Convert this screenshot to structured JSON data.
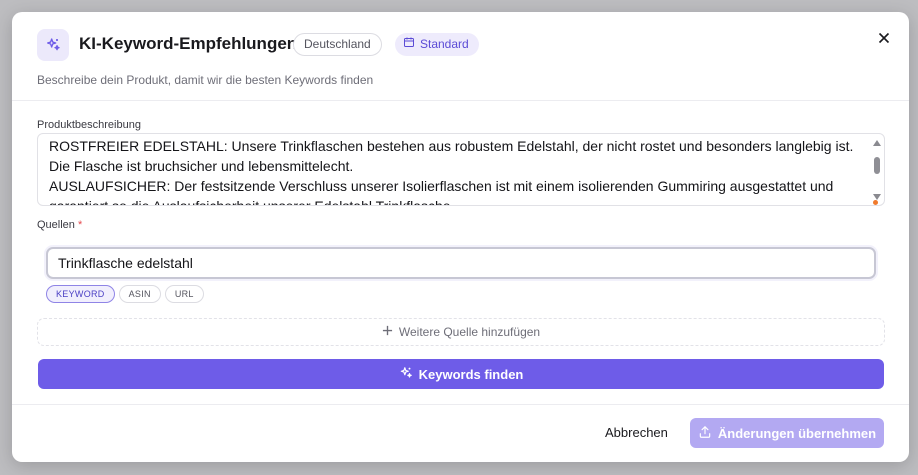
{
  "dialog": {
    "title": "KI-Keyword-Empfehlungen",
    "country_badge": "Deutschland",
    "mode_badge": "Standard",
    "subtitle": "Beschreibe dein Produkt, damit wir die besten Keywords finden"
  },
  "description": {
    "label": "Produktbeschreibung",
    "value": "ROSTFREIER EDELSTAHL: Unsere Trinkflaschen bestehen aus robustem Edelstahl, der nicht rostet und besonders langlebig ist. Die Flasche ist bruchsicher und lebensmittelecht.\nAUSLAUFSICHER: Der festsitzende Verschluss unserer Isolierflaschen ist mit einem isolierenden Gummiring ausgestattet und garantiert so die Auslaufsicherheit unserer Edelstahl Trinkflasche."
  },
  "sources": {
    "label": "Quellen",
    "required_mark": "*",
    "input_value": "Trinkflasche edelstahl",
    "types": [
      "KEYWORD",
      "ASIN",
      "URL"
    ],
    "active_type": "KEYWORD",
    "add_label": "Weitere Quelle hinzufügen"
  },
  "actions": {
    "find_label": "Keywords finden",
    "cancel_label": "Abbrechen",
    "apply_label": "Änderungen übernehmen"
  },
  "colors": {
    "accent": "#6e5ce8",
    "accent_disabled": "#b3a9f2",
    "badge_bg": "#eeebfc",
    "required": "#e5484d"
  }
}
